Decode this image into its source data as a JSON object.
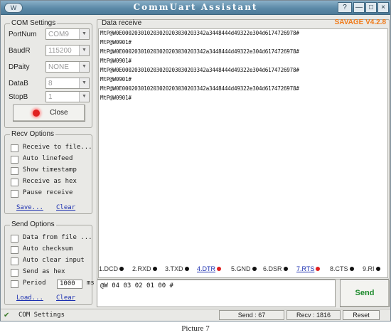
{
  "window": {
    "title": "CommUart Assistant",
    "app_icon": "W",
    "controls": {
      "help": "?",
      "minimize": "—",
      "maximize": "□",
      "close": "×"
    }
  },
  "com_settings": {
    "title": "COM Settings",
    "fields": [
      {
        "label": "PortNum",
        "value": "COM9"
      },
      {
        "label": "BaudR",
        "value": "115200"
      },
      {
        "label": "DPaity",
        "value": "NONE"
      },
      {
        "label": "DataB",
        "value": "8"
      },
      {
        "label": "StopB",
        "value": "1"
      }
    ],
    "close_button": "Close",
    "indicator_color": "#e02020"
  },
  "recv_options": {
    "title": "Recv Options",
    "checkboxes": [
      "Receive to file...",
      "Auto linefeed",
      "Show timestamp",
      "Receive as hex",
      "Pause receive"
    ],
    "save_link": "Save...",
    "clear_link": "Clear"
  },
  "send_options": {
    "title": "Send Options",
    "checkboxes": [
      "Data from file ...",
      "Auto checksum",
      "Auto clear input",
      "Send as hex"
    ],
    "period_label": "Period",
    "period_value": "1000",
    "period_unit": "ms",
    "load_link": "Load...",
    "clear_link": "Clear"
  },
  "receive": {
    "title": "Data receive",
    "version": "SAVAGE V4.2.8",
    "lines": [
      "MtP@W0E000203010203020203030203342a3448444d49322e304d6174726978#",
      "MtP@W0901#",
      "MtP@W0E000203010203020203030203342a3448444d49322e304d6174726978#",
      "MtP@W0901#",
      "MtP@W0E000203010203020203030203342a3448444d49322e304d6174726978#",
      "MtP@W0901#",
      "MtP@W0E000203010203020203030203342a3448444d49322e304d6174726978#",
      "MtP@W0901#"
    ]
  },
  "signals": [
    {
      "label": "1.DCD",
      "color": "#111111"
    },
    {
      "label": "2.RXD",
      "color": "#111111"
    },
    {
      "label": "3.TXD",
      "color": "#111111"
    },
    {
      "label": "4.DTR",
      "color": "#e02020"
    },
    {
      "label": "5.GND",
      "color": "#111111"
    },
    {
      "label": "6.DSR",
      "color": "#111111"
    },
    {
      "label": "7.RTS",
      "color": "#e02020"
    },
    {
      "label": "8.CTS",
      "color": "#111111"
    },
    {
      "label": "9.RI",
      "color": "#111111"
    }
  ],
  "send": {
    "text": "@W 04 03 02 01 00 #",
    "button": "Send"
  },
  "status": {
    "text": "COM Settings",
    "send_count": "Send : 67",
    "recv_count": "Recv : 1816",
    "reset_button": "Reset"
  },
  "caption": "Picture 7"
}
